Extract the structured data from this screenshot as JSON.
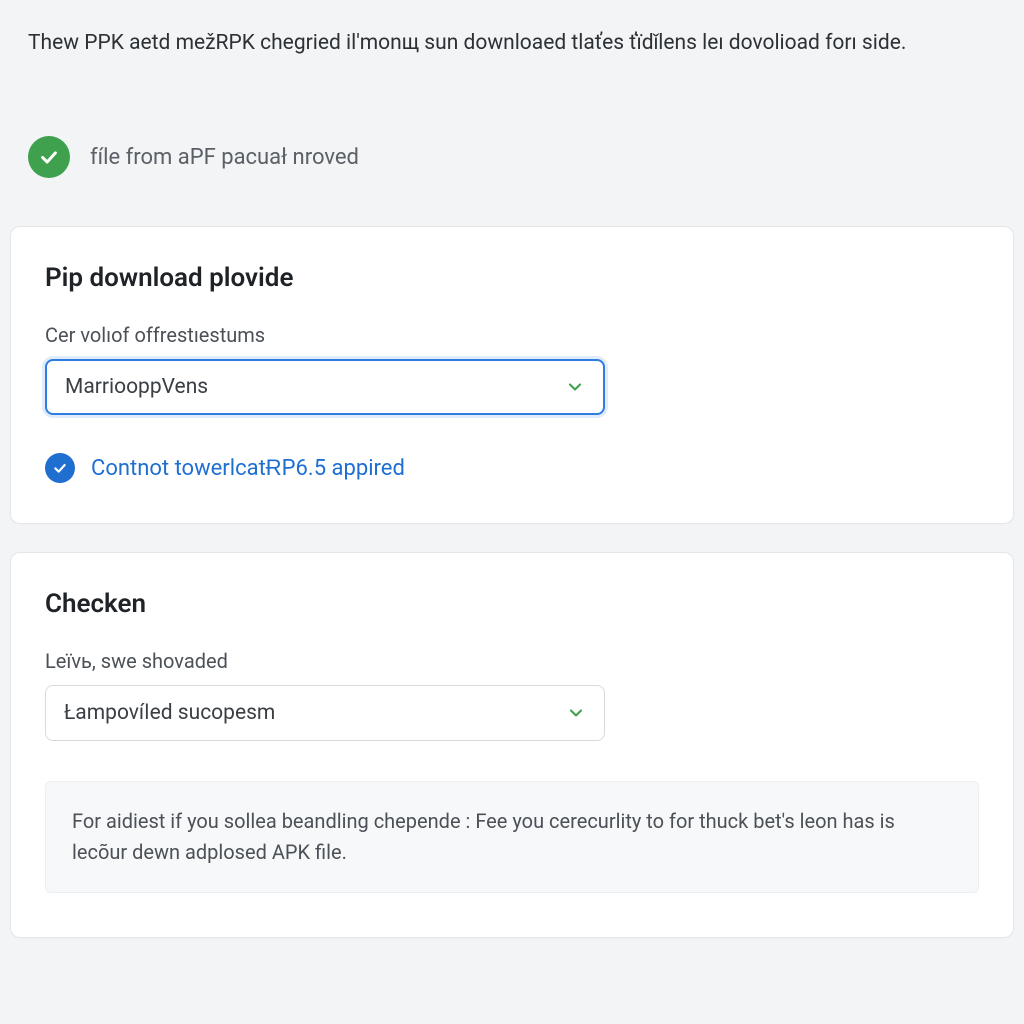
{
  "intro_text": "Thew PPK aеtd mežRPK chegried il'monщ sun downloaed tlaťes ťïdǐlens leı dovolioad forı side.",
  "status": {
    "text": "fíle from aPF pacuał nroved"
  },
  "card1": {
    "title": "Pip download plovide",
    "field_label": "Cer volıof offrestıestums",
    "select_value": "MarriooppVens",
    "verify_text": "Contnot towerlcatɌP6.5 appired"
  },
  "card2": {
    "title": "Checken",
    "field_label": "Leïvь, swe shovaded",
    "select_value": "Łampovíǀed sucopesm",
    "note": "For aidiest if you sollea beandling chepende : Fee you cerecurlity to for thuck bet's leon has is lecõur dewn adplosed APK file."
  }
}
